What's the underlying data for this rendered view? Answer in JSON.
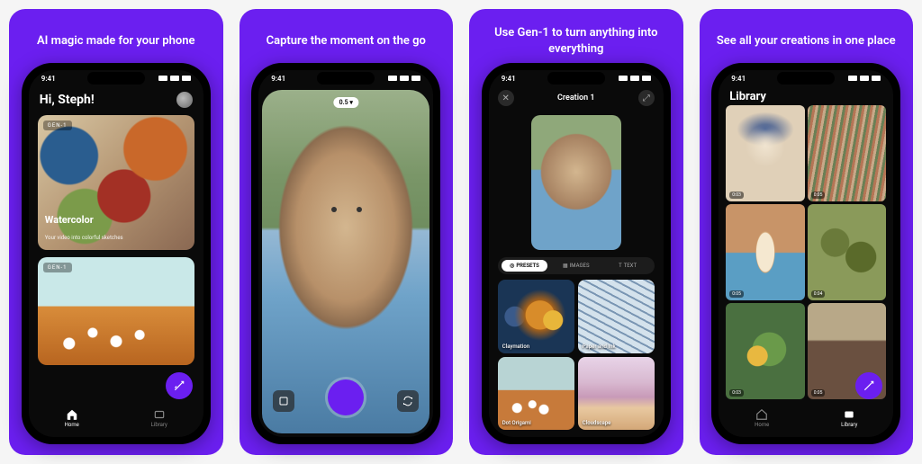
{
  "panels": [
    {
      "caption": "AI magic made for your phone"
    },
    {
      "caption": "Capture the moment on the go"
    },
    {
      "caption": "Use Gen-1 to turn anything into everything"
    },
    {
      "caption": "See all your creations in one place"
    }
  ],
  "status": {
    "time": "9:41"
  },
  "p1": {
    "greeting": "Hi, Steph!",
    "card1": {
      "badge": "GEN-1",
      "title": "Watercolor",
      "subtitle": "Your video into colorful sketches"
    },
    "card2": {
      "badge": "GEN-1"
    },
    "tabs": {
      "home": "Home",
      "library": "Library"
    }
  },
  "p2": {
    "timer": "0.5"
  },
  "p3": {
    "title": "Creation 1",
    "tabs": {
      "presets": "PRESETS",
      "images": "IMAGES",
      "text": "TEXT"
    },
    "tiles": {
      "a": "Claymation",
      "b": "Paper and Ink",
      "c": "Dot Origami",
      "d": "Cloudscape"
    }
  },
  "p4": {
    "title": "Library",
    "durs": {
      "a": "0:03",
      "b": "0:05",
      "c": "0:05",
      "d": "0:04",
      "e": "0:03",
      "f": "0:05"
    },
    "tabs": {
      "home": "Home",
      "library": "Library"
    }
  }
}
